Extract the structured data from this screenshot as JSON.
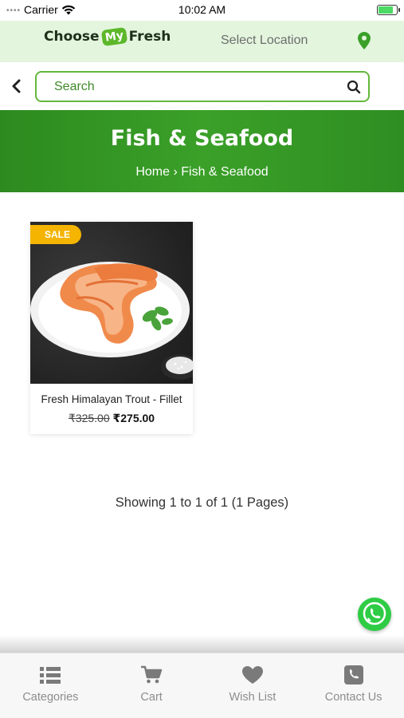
{
  "status_bar": {
    "carrier": "Carrier",
    "time": "10:02 AM",
    "battery_level": 0.85
  },
  "header": {
    "logo_left": "Choose",
    "logo_mid": "My",
    "logo_right": "Fresh",
    "location_label": "Select Location"
  },
  "search": {
    "placeholder": "Search"
  },
  "banner": {
    "title": "Fish & Seafood",
    "breadcrumb": "Home › Fish & Seafood"
  },
  "products": [
    {
      "badge": "SALE",
      "name": "Fresh Himalayan Trout - Fillet",
      "old_price": "₹325.00",
      "new_price": "₹275.00"
    }
  ],
  "pagination": {
    "info": "Showing 1 to 1 of 1 (1 Pages)"
  },
  "nav": {
    "items": [
      {
        "label": "Categories",
        "icon": "list-icon"
      },
      {
        "label": "Cart",
        "icon": "cart-icon"
      },
      {
        "label": "Wish List",
        "icon": "heart-icon"
      },
      {
        "label": "Contact Us",
        "icon": "phone-icon"
      }
    ]
  },
  "colors": {
    "accent": "#3aa028",
    "header_bg": "#e3f5dd",
    "sale": "#f4b400",
    "whatsapp": "#2ecc45"
  }
}
